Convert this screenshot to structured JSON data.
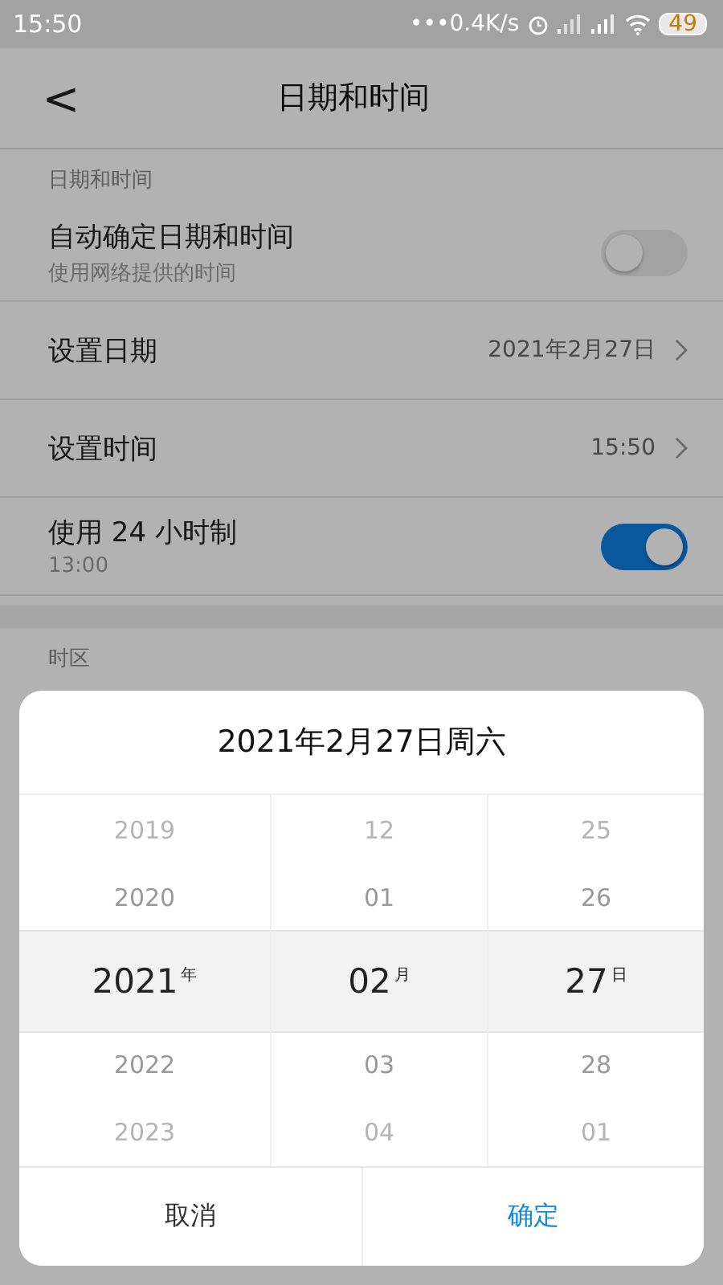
{
  "status_bar": {
    "time": "15:50",
    "speed": "•••0.4K/s",
    "battery": "49"
  },
  "header": {
    "back": "<",
    "title": "日期和时间"
  },
  "section_label": "日期和时间",
  "rows": [
    {
      "kind": "toggle",
      "title": "自动确定日期和时间",
      "subtitle": "使用网络提供的时间",
      "on": false
    },
    {
      "kind": "link",
      "title": "设置日期",
      "value": "2021年2月27日"
    },
    {
      "kind": "link",
      "title": "设置时间",
      "value": "15:50"
    },
    {
      "kind": "toggle",
      "title": "使用 24 小时制",
      "subtitle": "13:00",
      "on": true
    }
  ],
  "section_label_2": "时区",
  "dialog": {
    "title": "2021年2月27日周六",
    "columns": [
      {
        "items": [
          {
            "text": "2019",
            "selected": false
          },
          {
            "text": "2020",
            "selected": false
          },
          {
            "text": "2021",
            "unit": "年",
            "selected": true
          },
          {
            "text": "2022",
            "selected": false
          },
          {
            "text": "2023",
            "selected": false
          }
        ]
      },
      {
        "items": [
          {
            "text": "12",
            "selected": false
          },
          {
            "text": "01",
            "selected": false
          },
          {
            "text": "02",
            "unit": "月",
            "selected": true
          },
          {
            "text": "03",
            "selected": false
          },
          {
            "text": "04",
            "selected": false
          }
        ]
      },
      {
        "items": [
          {
            "text": "25",
            "selected": false
          },
          {
            "text": "26",
            "selected": false
          },
          {
            "text": "27",
            "unit": "日",
            "selected": true
          },
          {
            "text": "28",
            "selected": false
          },
          {
            "text": "01",
            "selected": false
          }
        ]
      }
    ],
    "cancel": "取消",
    "confirm": "确定"
  }
}
